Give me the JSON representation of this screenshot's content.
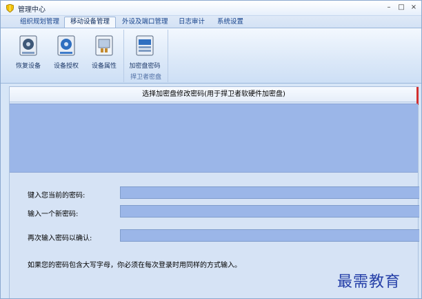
{
  "window": {
    "title": "管理中心",
    "controls": {
      "minimize": "–",
      "maximize": "□",
      "close": "×"
    }
  },
  "tabs": [
    {
      "label": "组织规划管理",
      "active": false
    },
    {
      "label": "移动设备管理",
      "active": true
    },
    {
      "label": "外设及端口管理",
      "active": false
    },
    {
      "label": "日志审计",
      "active": false
    },
    {
      "label": "系统设置",
      "active": false
    }
  ],
  "ribbon": {
    "buttons": [
      {
        "label": "恢复设备",
        "icon": "restore-device-icon"
      },
      {
        "label": "设备授权",
        "icon": "device-authorize-icon"
      },
      {
        "label": "设备属性",
        "icon": "device-properties-icon"
      },
      {
        "label": "加密盘密码",
        "icon": "encrypted-disk-password-icon"
      }
    ],
    "group_caption": "捍卫者密盘"
  },
  "content": {
    "header": "选择加密盘修改密码(用于捍卫者软硬件加密盘)",
    "fields": [
      {
        "label": "键入您当前的密码:",
        "value": ""
      },
      {
        "label": "输入一个新密码:",
        "value": ""
      },
      {
        "label": "再次输入密码以确认:",
        "value": ""
      }
    ],
    "note": "如果您的密码包含大写字母，你必须在每次登录时用同样的方式输入。"
  },
  "watermark": "最需教育",
  "colors": {
    "accent": "#15428b",
    "listbox": "#9bb6e8",
    "panel": "#d6e3f5"
  }
}
